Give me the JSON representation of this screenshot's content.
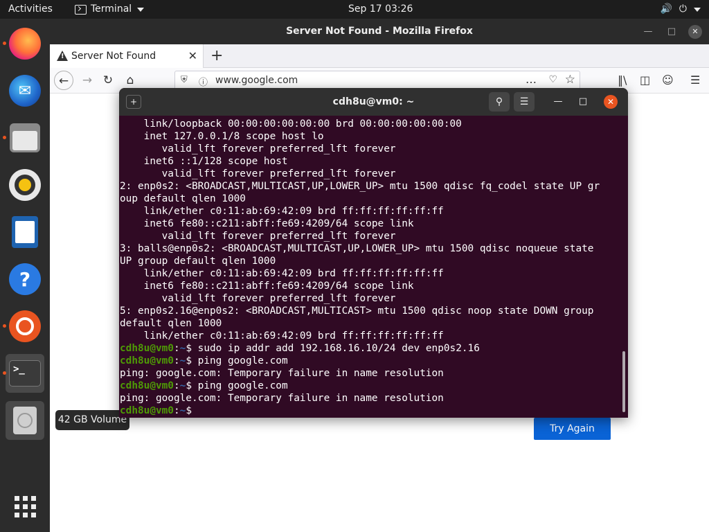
{
  "topbar": {
    "activities": "Activities",
    "app_name": "Terminal",
    "clock": "Sep 17  03:26"
  },
  "dock": {
    "items": [
      {
        "name": "firefox",
        "running": true
      },
      {
        "name": "thunderbird",
        "running": false
      },
      {
        "name": "files",
        "running": true
      },
      {
        "name": "rhythmbox",
        "running": false
      },
      {
        "name": "libreoffice-writer",
        "running": false
      },
      {
        "name": "help",
        "running": false
      },
      {
        "name": "ubuntu-software",
        "running": true
      },
      {
        "name": "terminal",
        "running": true
      },
      {
        "name": "volume",
        "running": false
      }
    ],
    "tooltip": "42 GB Volume"
  },
  "firefox": {
    "window_title": "Server Not Found - Mozilla Firefox",
    "tab_label": "Server Not Found",
    "url": "www.google.com",
    "try_again": "Try Again"
  },
  "terminal": {
    "title": "cdh8u@vm0: ~",
    "lines": [
      {
        "text": "    link/loopback 00:00:00:00:00:00 brd 00:00:00:00:00:00"
      },
      {
        "text": "    inet 127.0.0.1/8 scope host lo"
      },
      {
        "text": "       valid_lft forever preferred_lft forever"
      },
      {
        "text": "    inet6 ::1/128 scope host"
      },
      {
        "text": "       valid_lft forever preferred_lft forever"
      },
      {
        "text": "2: enp0s2: <BROADCAST,MULTICAST,UP,LOWER_UP> mtu 1500 qdisc fq_codel state UP gr"
      },
      {
        "text": "oup default qlen 1000"
      },
      {
        "text": "    link/ether c0:11:ab:69:42:09 brd ff:ff:ff:ff:ff:ff"
      },
      {
        "text": "    inet6 fe80::c211:abff:fe69:4209/64 scope link"
      },
      {
        "text": "       valid_lft forever preferred_lft forever"
      },
      {
        "text": "3: balls@enp0s2: <BROADCAST,MULTICAST,UP,LOWER_UP> mtu 1500 qdisc noqueue state"
      },
      {
        "text": "UP group default qlen 1000"
      },
      {
        "text": "    link/ether c0:11:ab:69:42:09 brd ff:ff:ff:ff:ff:ff"
      },
      {
        "text": "    inet6 fe80::c211:abff:fe69:4209/64 scope link"
      },
      {
        "text": "       valid_lft forever preferred_lft forever"
      },
      {
        "text": "5: enp0s2.16@enp0s2: <BROADCAST,MULTICAST> mtu 1500 qdisc noop state DOWN group"
      },
      {
        "text": "default qlen 1000"
      },
      {
        "text": "    link/ether c0:11:ab:69:42:09 brd ff:ff:ff:ff:ff:ff"
      },
      {
        "user": "cdh8u@vm0",
        "path": "~",
        "cmd": "sudo ip addr add 192.168.16.10/24 dev enp0s2.16"
      },
      {
        "user": "cdh8u@vm0",
        "path": "~",
        "cmd": "ping google.com"
      },
      {
        "text": "ping: google.com: Temporary failure in name resolution"
      },
      {
        "user": "cdh8u@vm0",
        "path": "~",
        "cmd": "ping google.com"
      },
      {
        "text": "ping: google.com: Temporary failure in name resolution"
      },
      {
        "user": "cdh8u@vm0",
        "path": "~",
        "cmd": ""
      }
    ]
  },
  "colors": {
    "terminal_bg": "#300a24",
    "prompt_user": "#4e9a06",
    "prompt_path": "#3465a4",
    "accent": "#e95420",
    "button_blue": "#0a63d6"
  }
}
